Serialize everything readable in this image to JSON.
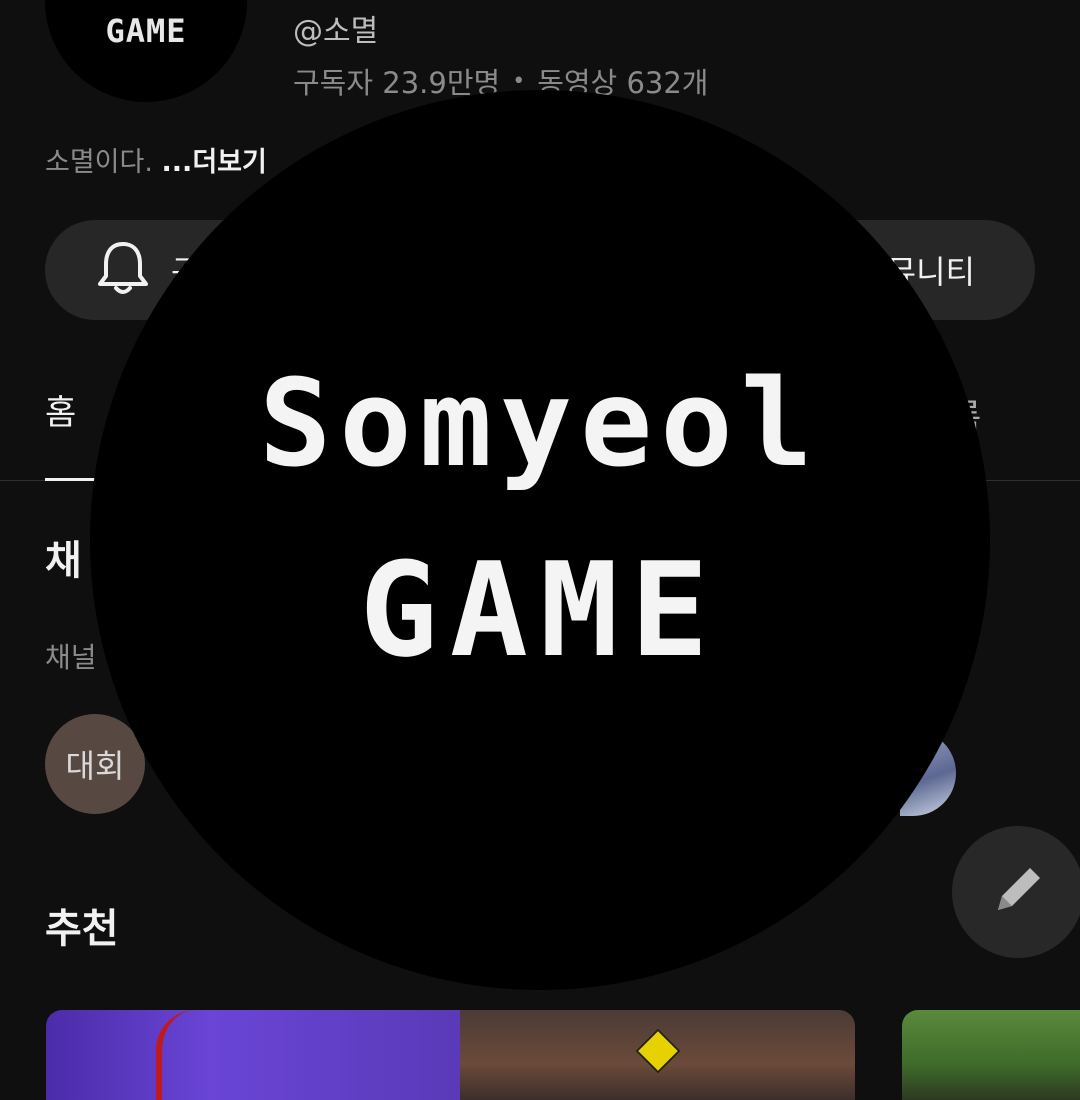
{
  "channel": {
    "avatar_text": "GAME",
    "handle": "@소멸",
    "subscribers": "구독자 23.9만명",
    "separator": "•",
    "videos": "동영상 632개",
    "description": "소멸이다.",
    "more_label": "...더보기"
  },
  "actions": {
    "subscribe_partial": "구",
    "community_partial": "뮤니티"
  },
  "tabs": {
    "first_partial": "홈",
    "last_partial": "록"
  },
  "sections": {
    "channels_title_partial": "채",
    "channels_subtitle_partial": "채널",
    "chip_label": "대회",
    "recommended_title": "추천"
  },
  "overlay_logo": {
    "line1": "Somyeol",
    "line2": "GAME"
  },
  "colors": {
    "background": "#0f0f0f",
    "pill": "#272727",
    "overlay": "#000000"
  }
}
